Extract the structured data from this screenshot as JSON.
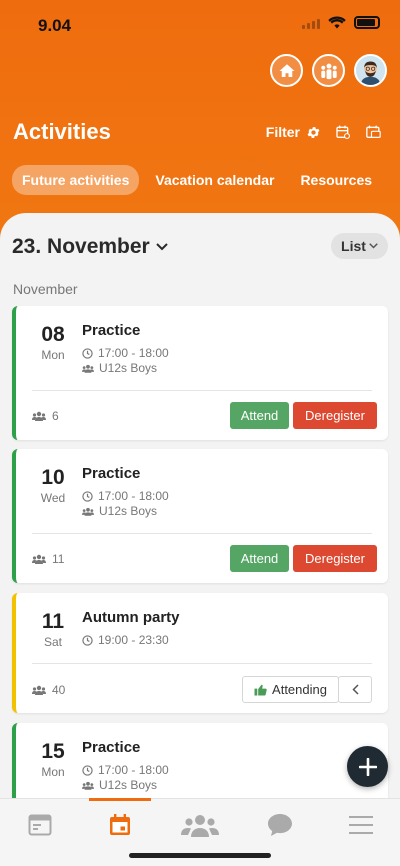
{
  "status": {
    "time": "9.04"
  },
  "header": {
    "title": "Activities",
    "filter_label": "Filter",
    "tabs": [
      {
        "label": "Future activities",
        "active": true
      },
      {
        "label": "Vacation calendar",
        "active": false
      },
      {
        "label": "Resources",
        "active": false
      }
    ]
  },
  "main": {
    "month_selector": "23. November",
    "view_toggle": "List",
    "section_label": "November"
  },
  "events": [
    {
      "day": "08",
      "weekday": "Mon",
      "title": "Practice",
      "time": "17:00 - 18:00",
      "group": "U12s Boys",
      "count": "6",
      "attend_label": "Attend",
      "deregister_label": "Deregister"
    },
    {
      "day": "10",
      "weekday": "Wed",
      "title": "Practice",
      "time": "17:00 - 18:00",
      "group": "U12s Boys",
      "count": "11",
      "attend_label": "Attend",
      "deregister_label": "Deregister"
    },
    {
      "day": "11",
      "weekday": "Sat",
      "title": "Autumn party",
      "time": "19:00 - 23:30",
      "count": "40",
      "attending_label": "Attending"
    },
    {
      "day": "15",
      "weekday": "Mon",
      "title": "Practice",
      "time": "17:00 - 18:00",
      "group": "U12s Boys"
    }
  ],
  "colors": {
    "brand_orange": "#ef6c0e",
    "attend_green": "#55a565",
    "deregister_red": "#dc4830",
    "status_green": "#2fa04a",
    "status_yellow": "#f2c200"
  },
  "icons": {
    "top_actions": [
      "home-icon",
      "team-icon",
      "avatar"
    ],
    "header_tools": [
      "gear-icon",
      "calendar-settings-icon",
      "calendar-share-icon"
    ],
    "bottom_nav": [
      "feed-icon",
      "calendar-icon",
      "people-icon",
      "chat-icon",
      "menu-icon"
    ]
  }
}
